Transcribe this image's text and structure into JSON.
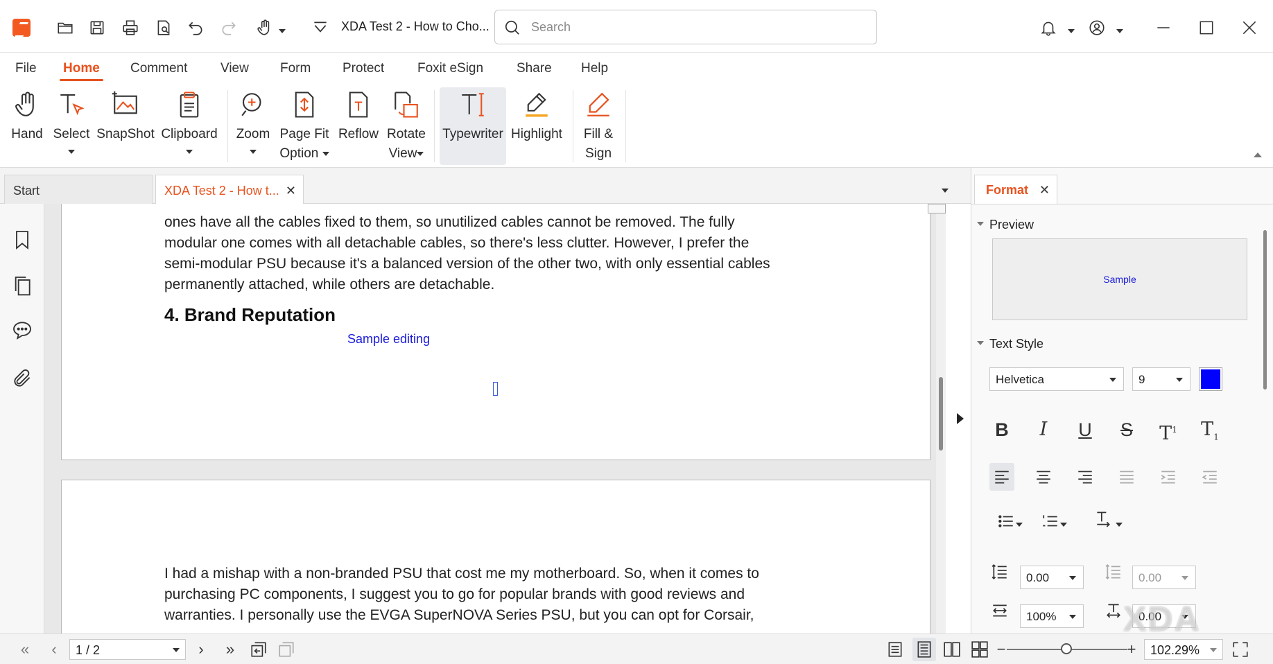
{
  "titlebar": {
    "doc_title": "XDA Test 2 - How to Cho...",
    "search_placeholder": "Search"
  },
  "menu_tabs": [
    "File",
    "Home",
    "Comment",
    "View",
    "Form",
    "Protect",
    "Foxit eSign",
    "Share",
    "Help"
  ],
  "active_menu_tab": "Home",
  "ribbon": {
    "hand": "Hand",
    "select": "Select",
    "snapshot": "SnapShot",
    "clipboard": "Clipboard",
    "zoom": "Zoom",
    "page_fit_1": "Page Fit",
    "page_fit_2": "Option",
    "reflow": "Reflow",
    "rotate_1": "Rotate",
    "rotate_2": "View",
    "typewriter": "Typewriter",
    "highlight": "Highlight",
    "fill_sign_1": "Fill &",
    "fill_sign_2": "Sign"
  },
  "doc_tabs": {
    "start": "Start",
    "current": "XDA Test 2 - How t..."
  },
  "document": {
    "para1_lines": [
      "ones have all the cables fixed to them, so unutilized cables cannot be removed. The fully",
      "modular one comes with all detachable cables, so there's less clutter. However, I prefer the",
      "semi-modular PSU because it's a balanced version of the other two, with only essential cables",
      "permanently attached, while others are detachable."
    ],
    "heading": "4. Brand Reputation",
    "annotation": "Sample editing",
    "para2_lines": [
      "I had a mishap with a non-branded PSU that cost me my motherboard. So, when it comes to",
      "purchasing PC components, I suggest you to go for popular brands with good reviews and",
      "warranties. I personally use the EVGA SuperNOVA Series PSU, but you can opt for Corsair,"
    ]
  },
  "format_panel": {
    "tab_label": "Format",
    "preview_label": "Preview",
    "preview_sample": "Sample",
    "text_style_label": "Text Style",
    "font": "Helvetica",
    "font_size": "9",
    "font_color": "#0000ff",
    "line_spacing": "0.00",
    "para_spacing": "0.00",
    "char_scale": "100%",
    "char_spacing": "0.00"
  },
  "statusbar": {
    "page": "1 / 2",
    "zoom": "102.29%"
  },
  "watermark": "XDA",
  "colors": {
    "accent": "#e8521e",
    "annotation_blue": "#1a1adb"
  }
}
